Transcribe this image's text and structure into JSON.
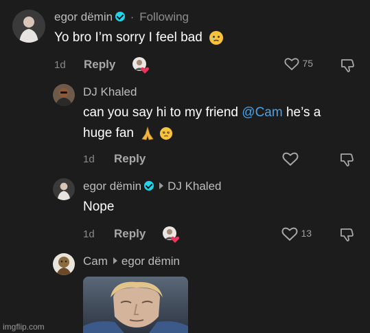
{
  "comments": [
    {
      "author": "egor dëmin",
      "verified": true,
      "separator": "·",
      "following": "Following",
      "text": "Yo bro I’m sorry I feel bad",
      "emoji_icon": "face-holding-back-tears",
      "age": "1d",
      "reply_label": "Reply",
      "like_count": "75"
    },
    {
      "author": "DJ Khaled",
      "text_line1_prefix": "can you say hi to my friend ",
      "mention": "@Cam",
      "text_line1_suffix": " he’s a",
      "text_line2": "huge fan",
      "emoji_icons": [
        "folded-hands",
        "face-holding-back-tears"
      ],
      "age": "1d",
      "reply_label": "Reply",
      "like_count": ""
    },
    {
      "author": "egor dëmin",
      "verified": true,
      "reply_to": "DJ Khaled",
      "text": "Nope",
      "age": "1d",
      "reply_label": "Reply",
      "like_count": "13"
    },
    {
      "author": "Cam",
      "reply_to": "egor dëmin",
      "attachment": "image"
    }
  ],
  "watermark": "imgflip.com",
  "colors": {
    "background": "#1c1c1c",
    "mention": "#4aa3e8",
    "verified": "#20d5ec",
    "creator_heart": "#e8365d"
  }
}
